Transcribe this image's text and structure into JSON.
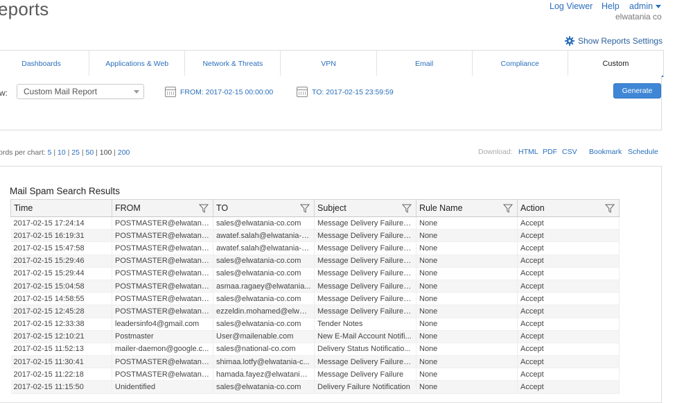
{
  "header": {
    "title": "eports",
    "links": {
      "log_viewer": "Log Viewer",
      "help": "Help",
      "admin": "admin"
    },
    "org": "elwatania co",
    "settings_label": "Show Reports Settings"
  },
  "tabs": [
    {
      "label": "Dashboards",
      "active": false
    },
    {
      "label": "Applications & Web",
      "active": false
    },
    {
      "label": "Network & Threats",
      "active": false
    },
    {
      "label": "VPN",
      "active": false
    },
    {
      "label": "Email",
      "active": false
    },
    {
      "label": "Compliance",
      "active": false
    },
    {
      "label": "Custom",
      "active": true
    }
  ],
  "filters": {
    "view_label": "w:",
    "view_selected": "Custom Mail Report",
    "from": "FROM: 2017-02-15 00:00:00",
    "to": "TO: 2017-02-15 23:59:59",
    "generate": "Generate"
  },
  "records": {
    "label": "ords per chart:",
    "options": [
      "5",
      "10",
      "25",
      "50",
      "100",
      "200"
    ],
    "selected": "100"
  },
  "download": {
    "label": "Download:",
    "html": "HTML",
    "pdf": "PDF",
    "csv": "CSV",
    "bookmark": "Bookmark",
    "schedule": "Schedule"
  },
  "results": {
    "title": "Mail Spam Search Results",
    "columns": [
      "Time",
      "FROM",
      "TO",
      "Subject",
      "Rule Name",
      "Action"
    ],
    "rows": [
      [
        "2017-02-15 17:24:14",
        "POSTMASTER@elwatania-...",
        "sales@elwatania-co.com",
        "Message Delivery Failure -...",
        "None",
        "Accept"
      ],
      [
        "2017-02-15 16:19:31",
        "POSTMASTER@elwatania-...",
        "awatef.salah@elwatania-c...",
        "Message Delivery Failure -...",
        "None",
        "Accept"
      ],
      [
        "2017-02-15 15:47:58",
        "POSTMASTER@elwatania-...",
        "awatef.salah@elwatania-c...",
        "Message Delivery Failure -...",
        "None",
        "Accept"
      ],
      [
        "2017-02-15 15:29:46",
        "POSTMASTER@elwatania-...",
        "sales@elwatania-co.com",
        "Message Delivery Failure -...",
        "None",
        "Accept"
      ],
      [
        "2017-02-15 15:29:44",
        "POSTMASTER@elwatania-...",
        "sales@elwatania-co.com",
        "Message Delivery Failure -...",
        "None",
        "Accept"
      ],
      [
        "2017-02-15 15:04:58",
        "POSTMASTER@elwatania-...",
        "asmaa.ragaey@elwatania...",
        "Message Delivery Failure -...",
        "None",
        "Accept"
      ],
      [
        "2017-02-15 14:58:55",
        "POSTMASTER@elwatania-...",
        "sales@elwatania-co.com",
        "Message Delivery Failure -...",
        "None",
        "Accept"
      ],
      [
        "2017-02-15 12:45:28",
        "POSTMASTER@elwatania-...",
        "ezzeldin.mohamed@elwat...",
        "Message Delivery Failure -...",
        "None",
        "Accept"
      ],
      [
        "2017-02-15 12:33:38",
        "leadersinfo4@gmail.com",
        "sales@elwatania-co.com",
        "Tender Notes",
        "None",
        "Accept"
      ],
      [
        "2017-02-15 12:10:21",
        "Postmaster",
        "User@mailenable.com",
        "New E-Mail Account Notifi...",
        "None",
        "Accept"
      ],
      [
        "2017-02-15 11:52:13",
        "mailer-daemon@google.c...",
        "sales@national-co.com",
        "Delivery Status Notificatio...",
        "None",
        "Accept"
      ],
      [
        "2017-02-15 11:30:41",
        "POSTMASTER@elwatania-...",
        "shimaa.lotfy@elwatania-c...",
        "Message Delivery Failure -...",
        "None",
        "Accept"
      ],
      [
        "2017-02-15 11:22:18",
        "POSTMASTER@elwatania-...",
        "hamada.fayez@elwatania-...",
        "Message Delivery Failure",
        "None",
        "Accept"
      ],
      [
        "2017-02-15 11:15:50",
        "Unidentified",
        "sales@elwatania-co.com",
        "Delivery Failure Notification",
        "None",
        "Accept"
      ]
    ]
  }
}
